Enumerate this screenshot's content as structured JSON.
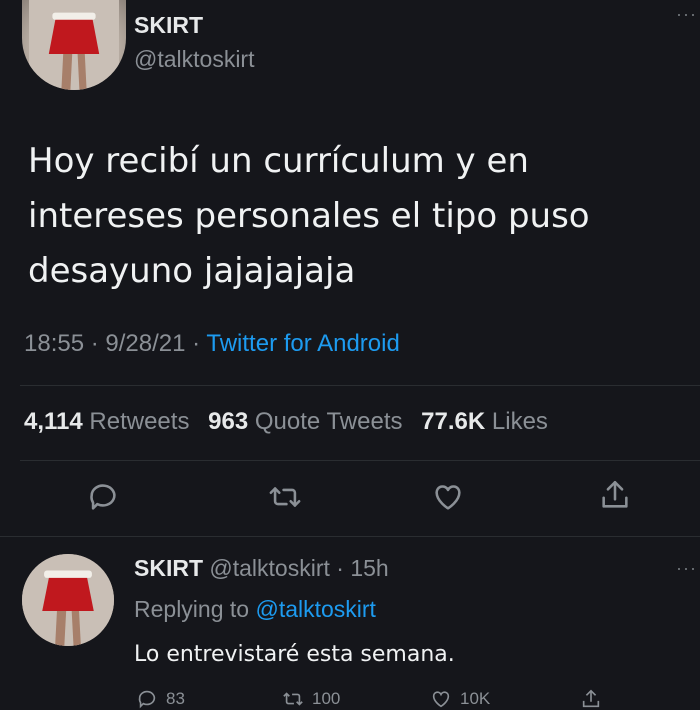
{
  "tweet": {
    "author_name": "SKIRT",
    "author_handle": "@talktoskirt",
    "text": "Hoy recibí un currículum y en intereses personales el tipo puso desayuno jajajajaja",
    "time": "18:55",
    "date": "9/28/21",
    "source": "Twitter for Android",
    "separator": "·",
    "more": "···"
  },
  "stats": {
    "retweets_count": "4,114",
    "retweets_label": "Retweets",
    "quotes_count": "963",
    "quotes_label": "Quote Tweets",
    "likes_count": "77.6K",
    "likes_label": "Likes"
  },
  "actions": [
    "reply-icon",
    "retweet-icon",
    "like-icon",
    "share-icon"
  ],
  "reply": {
    "author_name": "SKIRT",
    "author_handle": "@talktoskirt",
    "age": "15h",
    "separator": "·",
    "replying_prefix": "Replying to",
    "replying_to": "@talktoskirt",
    "text": "Lo entrevistaré esta semana.",
    "more": "···",
    "reply_count": "83",
    "retweet_count": "100",
    "like_count": "10K"
  },
  "colors": {
    "background": "#15161b",
    "accent": "#1d9bf0",
    "muted": "#8b9096"
  }
}
